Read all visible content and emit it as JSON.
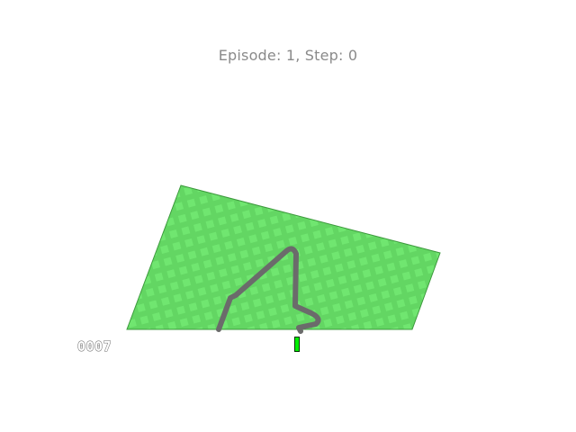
{
  "title": "Episode: 1, Step: 0",
  "hud": {
    "reward": "0007",
    "speed_fill": 1.0,
    "speed_color": "#00f000"
  },
  "colors": {
    "background": "#ffffff",
    "grass": "#63d663",
    "grass_tile": "#70e670",
    "track": "#6b6b6b"
  }
}
